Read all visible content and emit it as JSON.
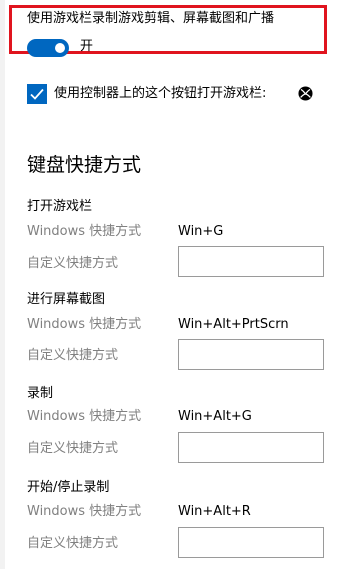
{
  "game_bar": {
    "toggle_title": "使用游戏栏录制游戏剪辑、屏幕截图和广播",
    "toggle_state": "开",
    "toggle_on": true,
    "controller_checkbox_label": "使用控制器上的这个按钮打开游戏栏:",
    "controller_checkbox_checked": true
  },
  "keyboard_shortcuts": {
    "title": "键盘快捷方式",
    "groups": [
      {
        "title": "打开游戏栏",
        "windows_label": "Windows 快捷方式",
        "windows_value": "Win+G",
        "custom_label": "自定义快捷方式",
        "custom_value": ""
      },
      {
        "title": "进行屏幕截图",
        "windows_label": "Windows 快捷方式",
        "windows_value": "Win+Alt+PrtScrn",
        "custom_label": "自定义快捷方式",
        "custom_value": ""
      },
      {
        "title": "录制",
        "windows_label": "Windows 快捷方式",
        "windows_value": "Win+Alt+G",
        "custom_label": "自定义快捷方式",
        "custom_value": ""
      },
      {
        "title": "开始/停止录制",
        "windows_label": "Windows 快捷方式",
        "windows_value": "Win+Alt+R",
        "custom_label": "自定义快捷方式",
        "custom_value": ""
      }
    ]
  },
  "colors": {
    "accent": "#0067c0",
    "highlight_border": "#e0141e",
    "secondary_text": "#808080"
  },
  "icons": {
    "checkmark": "checkmark-icon",
    "controller_button": "xbox-icon"
  }
}
